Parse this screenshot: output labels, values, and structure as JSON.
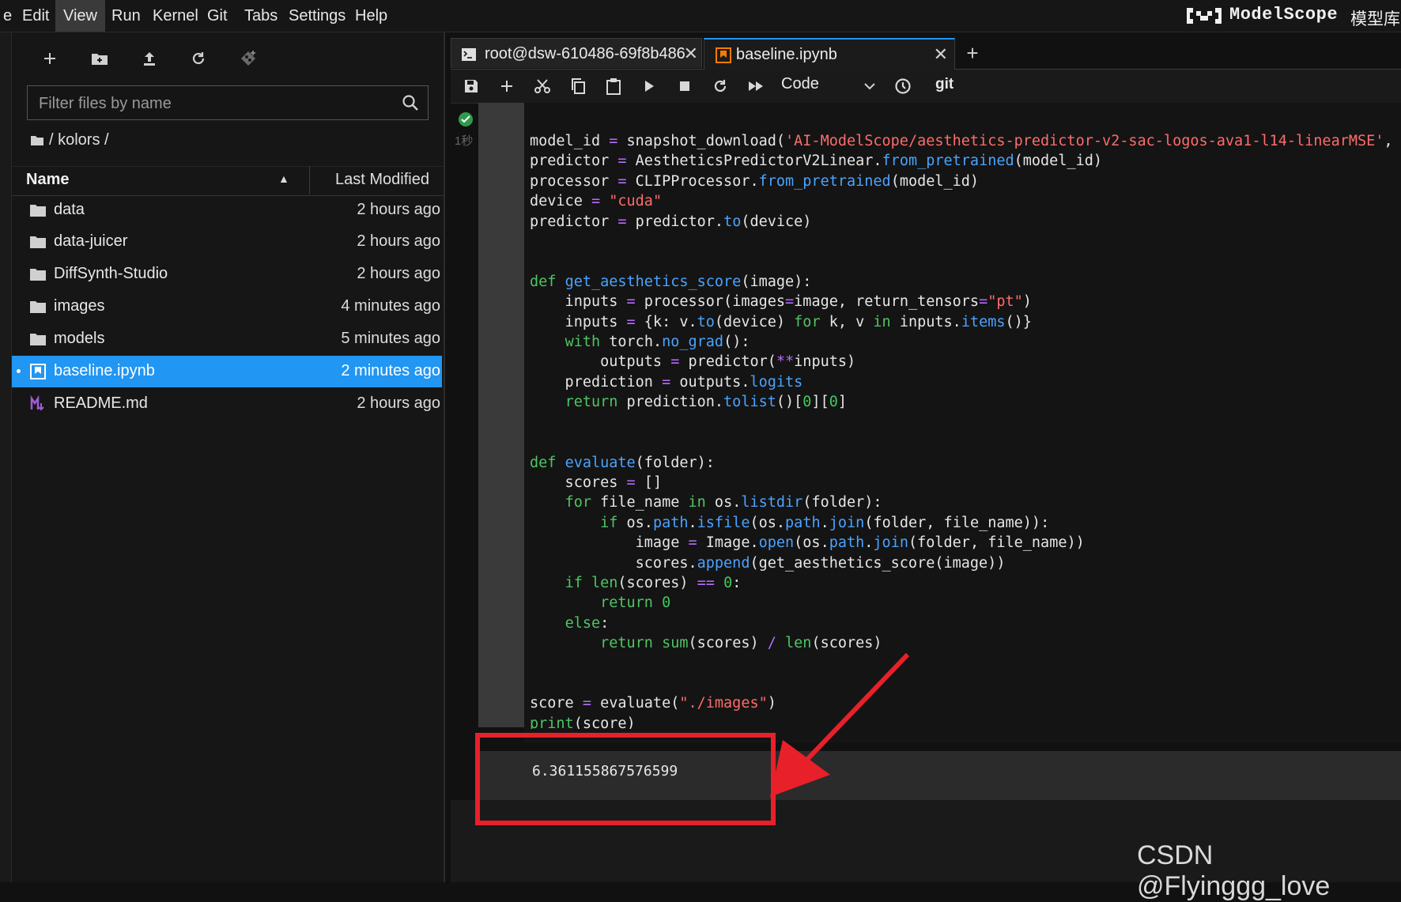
{
  "menubar": {
    "items": [
      "e",
      "Edit",
      "View",
      "Run",
      "Kernel",
      "Git",
      "Tabs",
      "Settings",
      "Help"
    ],
    "active": "View",
    "brand": "ModelScope",
    "brand_cn": "模型库"
  },
  "filebrowser": {
    "filter_placeholder": "Filter files by name",
    "breadcrumb": "/ kolors /",
    "col_name": "Name",
    "col_modified": "Last Modified",
    "files": [
      {
        "name": "data",
        "modified": "2 hours ago",
        "type": "folder"
      },
      {
        "name": "data-juicer",
        "modified": "2 hours ago",
        "type": "folder"
      },
      {
        "name": "DiffSynth-Studio",
        "modified": "2 hours ago",
        "type": "folder"
      },
      {
        "name": "images",
        "modified": "4 minutes ago",
        "type": "folder"
      },
      {
        "name": "models",
        "modified": "5 minutes ago",
        "type": "folder"
      },
      {
        "name": "baseline.ipynb",
        "modified": "2 minutes ago",
        "type": "notebook",
        "selected": true
      },
      {
        "name": "README.md",
        "modified": "2 hours ago",
        "type": "markdown"
      }
    ]
  },
  "tabs": [
    {
      "label": "root@dsw-610486-69f8b486",
      "icon": "terminal-icon"
    },
    {
      "label": "baseline.ipynb",
      "icon": "notebook-icon",
      "active": true
    }
  ],
  "toolbar": {
    "cell_type": "Code",
    "git_label": "git"
  },
  "cell": {
    "exec_time": "1秒",
    "output": "6.361155867576599"
  },
  "watermark": "CSDN @Flyinggg_love",
  "colors": {
    "accent": "#2196f3",
    "annotation": "#e8202a",
    "keyword": "#4fc463",
    "string": "#ff6b6b",
    "function": "#4aa3ff"
  }
}
